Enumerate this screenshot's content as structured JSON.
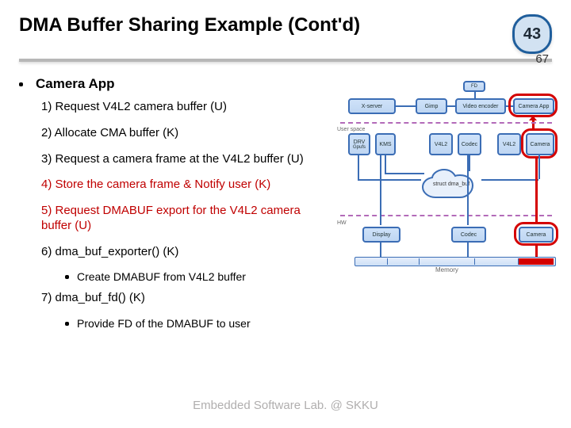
{
  "header": {
    "title": "DMA Buffer Sharing Example (Cont'd)",
    "slide_number": "43",
    "total_pages": "67"
  },
  "section": {
    "heading": "Camera App",
    "steps": [
      {
        "text": "1) Request V4L2 camera buffer (U)",
        "red": false
      },
      {
        "text": "2) Allocate CMA buffer (K)",
        "red": false
      },
      {
        "text": "3) Request a camera frame at the V4L2 buffer (U)",
        "red": false
      },
      {
        "text": "4) Store the camera frame & Notify user (K)",
        "red": true
      },
      {
        "text": "5) Request DMABUF export for the V4L2 camera buffer (U)",
        "red": true
      },
      {
        "text": "6) dma_buf_exporter() (K)",
        "red": false,
        "sub": "Create DMABUF from V4L2 buffer"
      },
      {
        "text": "7) dma_buf_fd() (K)",
        "red": false,
        "sub": "Provide FD of the DMABUF to user"
      }
    ]
  },
  "diagram": {
    "top_row": {
      "xserver": "X-server",
      "gimp": "Gimp",
      "video_encoder": "Video encoder",
      "camera_app": "Camera App",
      "fd": "FD"
    },
    "user_space_label": "User space",
    "mid_row": {
      "drv": "DRV",
      "gpufs": "Gpufs",
      "kms": "KMS",
      "v4l2_1": "V4L2",
      "codec": "Codec",
      "v4l2_2": "V4L2",
      "camera": "Camera"
    },
    "cloud": "struct dma_buf",
    "hw_label": "HW",
    "hw_row": {
      "display": "Display",
      "codec": "Codec",
      "camera": "Camera"
    },
    "memory": "Memory"
  },
  "footer": "Embedded Software Lab. @ SKKU"
}
